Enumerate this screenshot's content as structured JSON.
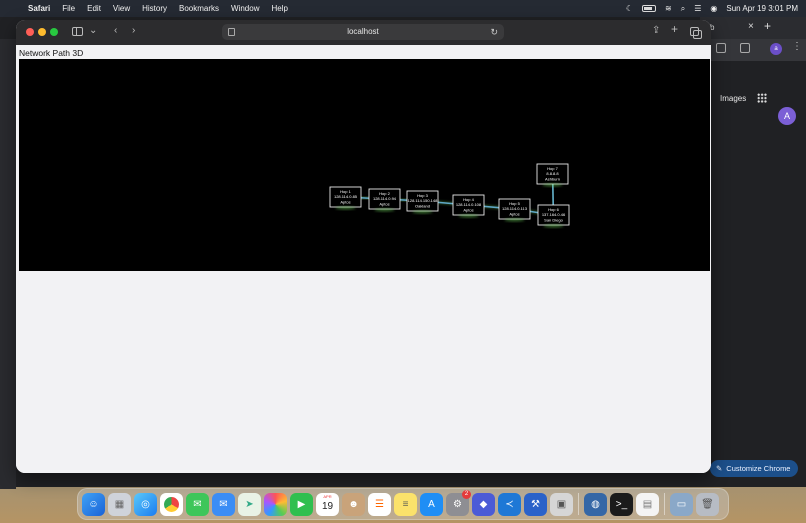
{
  "menubar": {
    "app_name": "Safari",
    "menus": [
      "File",
      "Edit",
      "View",
      "History",
      "Bookmarks",
      "Window",
      "Help"
    ],
    "datetime": "Sun Apr 19  3:01 PM"
  },
  "chrome": {
    "tab_fragment": "b",
    "images_link": "Images",
    "avatar_letter": "A",
    "avatar_small_letter": "a",
    "customize_label": "Customize Chrome"
  },
  "safari": {
    "address": "localhost",
    "page_title": "Network Path 3D",
    "hops": [
      {
        "label": "Hop 1",
        "ip": "128.114.0.85",
        "location": "Aptos"
      },
      {
        "label": "Hop 2",
        "ip": "128.114.0.94",
        "location": "Aptos"
      },
      {
        "label": "Hop 3",
        "ip": "128.114.150.148",
        "location": "Oakland"
      },
      {
        "label": "Hop 4",
        "ip": "128.114.0.108",
        "location": "Aptos"
      },
      {
        "label": "Hop 5",
        "ip": "128.114.0.113",
        "location": "Aptos"
      },
      {
        "label": "Hop 6",
        "ip": "137.164.0.46",
        "location": "San Diego"
      },
      {
        "label": "Hop 7",
        "ip": "8.8.8.8",
        "location": "Ashburn"
      }
    ],
    "colors": {
      "node_border": "#e8e8e8",
      "node_text": "#ffffff",
      "link": "#5fa8c8",
      "glow": "#6fd35f"
    }
  },
  "dock": {
    "calendar_month": "APR",
    "calendar_day": "19",
    "settings_badge": "2"
  }
}
